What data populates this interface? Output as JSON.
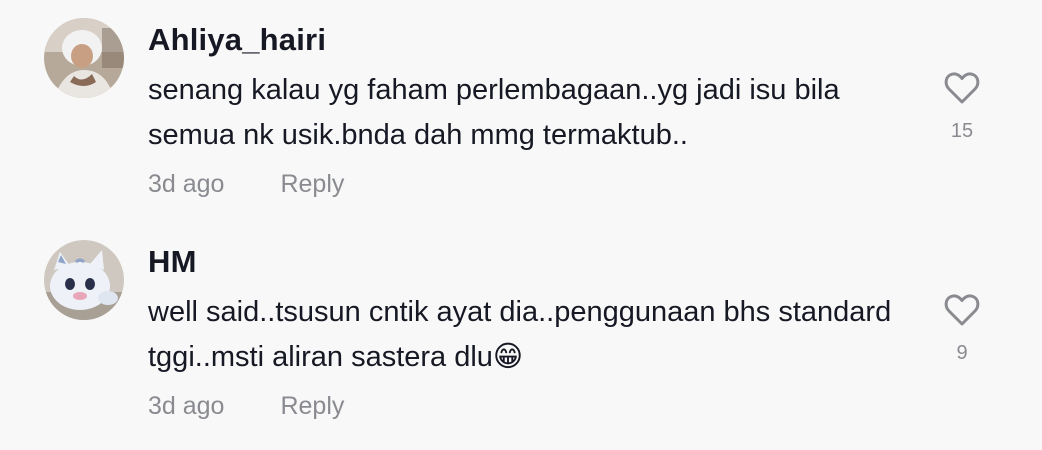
{
  "comments": [
    {
      "username": "Ahliya_hairi",
      "text": "senang kalau yg faham perlembagaan..yg jadi isu bila semua nk usik.bnda dah mmg termaktub..",
      "time": "3d ago",
      "reply_label": "Reply",
      "likes": "15",
      "avatar_icon": "user-photo-avatar"
    },
    {
      "username": "HM",
      "text": "well said..tsusun cntik ayat dia..penggunaan bhs standard tggi..msti aliran sastera dlu😁",
      "time": "3d ago",
      "reply_label": "Reply",
      "likes": "9",
      "avatar_icon": "plush-cat-avatar"
    }
  ],
  "icons": {
    "like": "heart-outline-icon"
  },
  "colors": {
    "background": "#f8f8f8",
    "text": "#161823",
    "secondary": "#8a8b91"
  }
}
